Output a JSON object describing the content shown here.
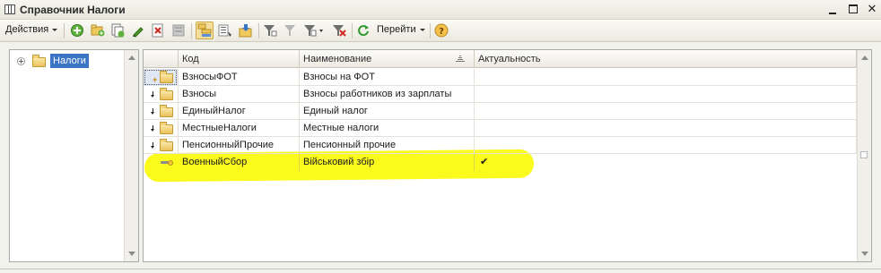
{
  "window": {
    "title": "Справочник Налоги",
    "min_icon": "minimize-icon",
    "max_icon": "maximize-icon",
    "close_glyph": "✕"
  },
  "toolbar": {
    "actions_label": "Действия",
    "goto_label": "Перейти",
    "icons": [
      "add-icon",
      "add-group-icon",
      "copy-icon",
      "edit-icon",
      "delete-icon",
      "mark-delete-icon",
      "hierarchy-view-icon",
      "list-view-icon",
      "move-to-group-icon",
      "filter-icon",
      "filter-by-value-icon",
      "filter-settings-icon",
      "clear-filter-icon",
      "refresh-icon",
      "help-icon"
    ]
  },
  "tree": {
    "root_label": "Налоги",
    "expanded": false
  },
  "grid": {
    "columns": [
      "Код",
      "Наименование",
      "Актуальность"
    ],
    "sorted_column": "Наименование",
    "rows": [
      {
        "code": "ВзносыФОТ",
        "name": "Взносы на ФОТ",
        "actual": "",
        "type": "group",
        "selected": true
      },
      {
        "code": "Взносы",
        "name": "Взносы работников из зарплаты",
        "actual": "",
        "type": "group"
      },
      {
        "code": "ЕдиныйНалог",
        "name": "Единый налог",
        "actual": "",
        "type": "group"
      },
      {
        "code": "МестныеНалоги",
        "name": "Местные налоги",
        "actual": "",
        "type": "group"
      },
      {
        "code": "ПенсионныйПрочие",
        "name": "Пенсионный прочие",
        "actual": "",
        "type": "group"
      },
      {
        "code": "ВоенныйСбор",
        "name": "Військовий збір",
        "actual": "✔",
        "type": "item",
        "highlighted": true
      }
    ]
  },
  "colors": {
    "highlight": "#fafa10",
    "tree_selection": "#3a74c4"
  }
}
